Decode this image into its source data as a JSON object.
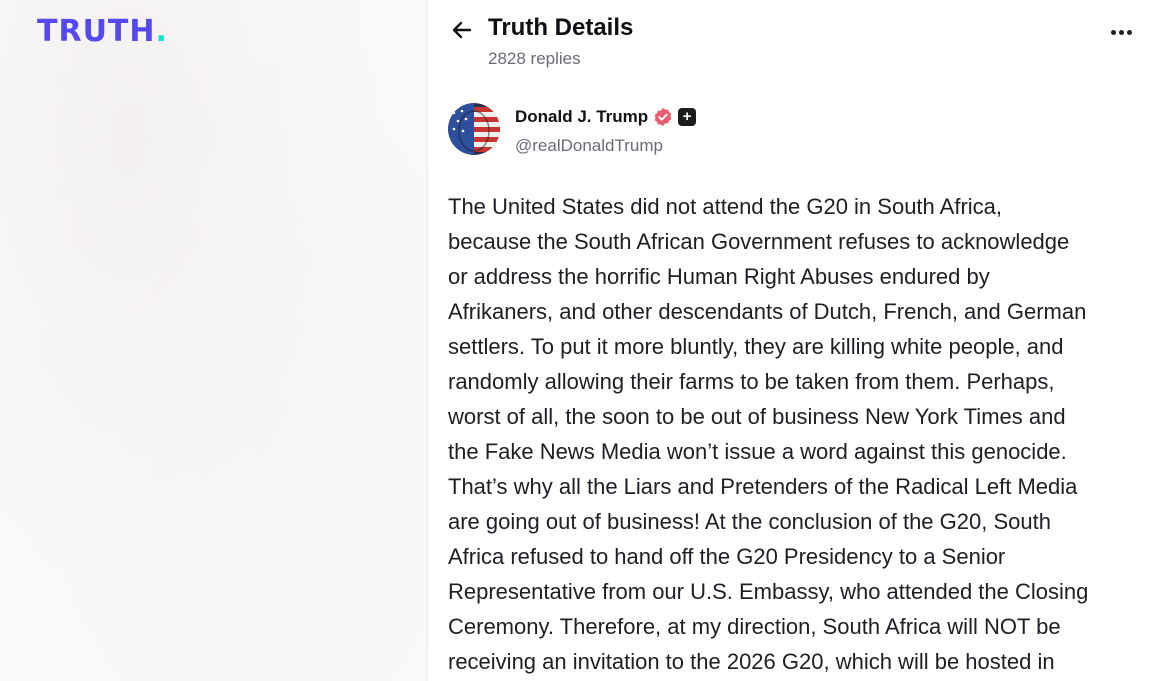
{
  "brand": {
    "logo_text": "TRUTH",
    "logo_dot": ".",
    "accent": "#5448ee",
    "dot_color": "#17e2c7"
  },
  "header": {
    "back_icon": "arrow-left-icon",
    "title": "Truth Details",
    "replies": "2828 replies",
    "more_icon": "ellipsis-icon"
  },
  "author": {
    "name": "Donald J. Trump",
    "handle": "@realDonaldTrump",
    "verified_icon": "verified-badge-icon",
    "plus_icon": "plus-badge-icon"
  },
  "post": {
    "lines": [
      "The United States did not attend the G20 in South Africa,",
      "because the South African Government refuses to acknowledge",
      "or address the horrific Human Right Abuses endured by",
      "Afrikaners, and other descendants of Dutch, French, and German",
      "settlers. To put it more bluntly, they are killing white people, and",
      "randomly allowing their farms to be taken from them. Perhaps,",
      "worst of all, the soon to be out of business New York Times and",
      "the Fake News Media won’t issue a word against this genocide.",
      "That’s why all the Liars and Pretenders of the Radical Left Media",
      "are going out of business! At the conclusion of the G20, South",
      "Africa refused to hand off the G20 Presidency to a Senior",
      "Representative from our U.S. Embassy, who attended the Closing",
      "Ceremony. Therefore, at my direction, South Africa will NOT be",
      "receiving an invitation to the 2026 G20, which will be hosted in"
    ]
  }
}
